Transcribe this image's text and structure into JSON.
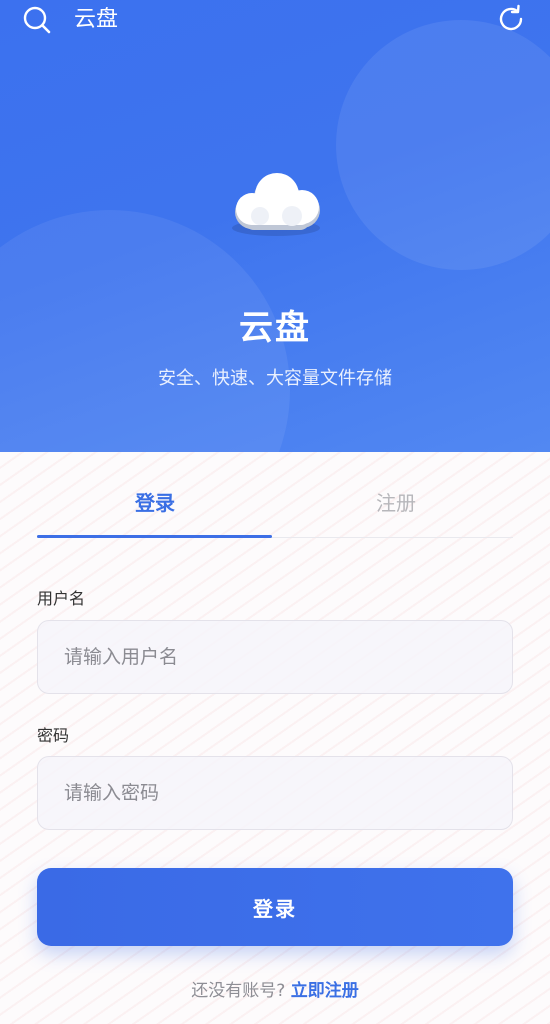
{
  "topbar": {
    "search_icon": "search-icon",
    "title": "云盘",
    "refresh_icon": "refresh-icon"
  },
  "hero": {
    "logo_icon": "cloud-icon",
    "title": "云盘",
    "subtitle": "安全、快速、大容量文件存储"
  },
  "tabs": [
    {
      "label": "登录",
      "active": true
    },
    {
      "label": "注册",
      "active": false
    }
  ],
  "form": {
    "username": {
      "label": "用户名",
      "placeholder": "请输入用户名",
      "value": ""
    },
    "password": {
      "label": "密码",
      "placeholder": "请输入密码",
      "value": ""
    },
    "submit_label": "登录"
  },
  "footer": {
    "prompt": "还没有账号?",
    "link": "立即注册"
  },
  "colors": {
    "primary": "#3d6fe6",
    "hero_gradient_start": "#3c71ef",
    "hero_gradient_end": "#5288f2",
    "muted_text": "#8e8e95"
  }
}
